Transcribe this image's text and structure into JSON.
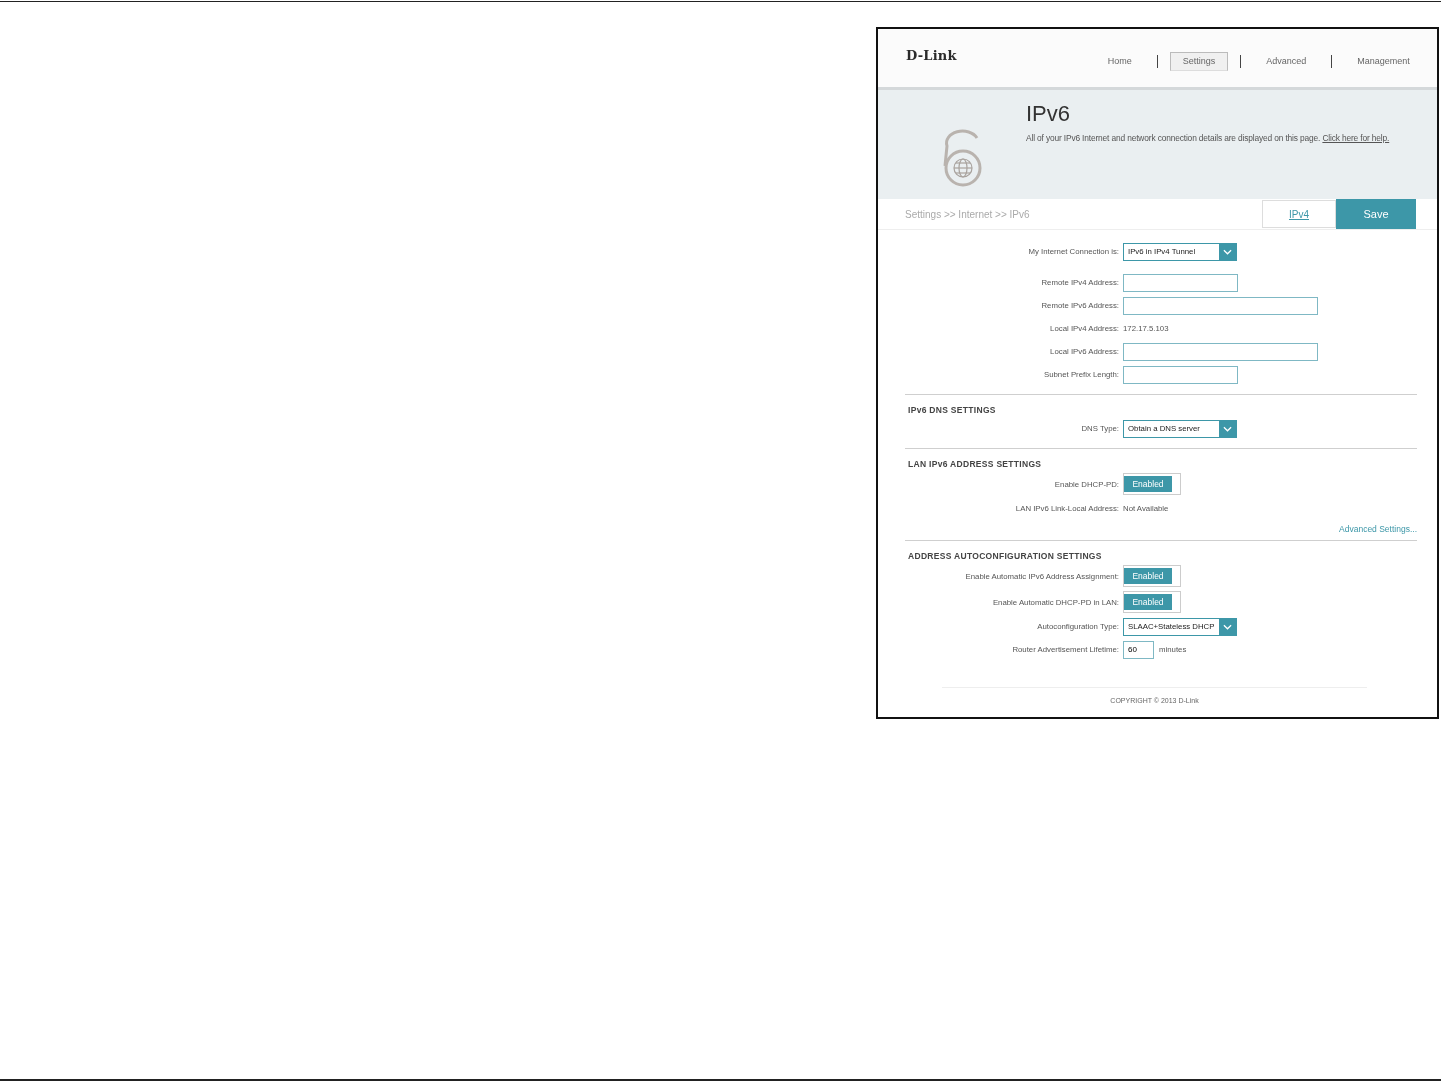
{
  "header": {
    "logo": "D-Link",
    "nav": [
      {
        "label": "Home",
        "selected": false
      },
      {
        "label": "Settings",
        "selected": true
      },
      {
        "label": "Advanced",
        "selected": false
      },
      {
        "label": "Management",
        "selected": false
      }
    ]
  },
  "hero": {
    "title": "IPv6",
    "description": "All of your IPv6 Internet and network connection details are displayed on this page.",
    "help_link": "Click here for help."
  },
  "toolbar": {
    "breadcrumb": "Settings >> Internet >> IPv6",
    "link": "IPv4",
    "save": "Save"
  },
  "sections": [
    {
      "rows": [
        {
          "kind": "select",
          "label": "My Internet Connection is:",
          "value": "IPv6 in IPv4 Tunnel"
        },
        {
          "kind": "field",
          "label": "Remote IPv4 Address:"
        },
        {
          "kind": "long-field",
          "label": "Remote IPv6 Address:"
        },
        {
          "kind": "text",
          "label": "Local IPv4 Address:",
          "value": "172.17.5.103"
        },
        {
          "kind": "long-field",
          "label": "Local IPv6 Address:"
        },
        {
          "kind": "field",
          "label": "Subnet Prefix Length:"
        }
      ]
    },
    {
      "heading": "IPv6 DNS SETTINGS",
      "rows": [
        {
          "kind": "select",
          "label": "DNS Type:",
          "value": "Obtain a DNS server"
        }
      ]
    },
    {
      "heading": "LAN IPv6 ADDRESS SETTINGS",
      "rows": [
        {
          "kind": "toggle",
          "label": "Enable DHCP-PD:",
          "value": "Enabled",
          "on": true
        },
        {
          "kind": "text",
          "label": "LAN IPv6 Link-Local Address:",
          "value": "Not Available"
        }
      ],
      "link": "Advanced Settings..."
    },
    {
      "heading": "ADDRESS AUTOCONFIGURATION SETTINGS",
      "rows": [
        {
          "kind": "toggle",
          "label": "Enable Automatic IPv6 Address Assignment:",
          "value": "Enabled",
          "on": true
        },
        {
          "kind": "toggle",
          "label": "Enable Automatic DHCP-PD in LAN:",
          "value": "Enabled",
          "on": true
        },
        {
          "kind": "select",
          "label": "Autoconfiguration Type:",
          "value": "SLAAC+Stateless DHCP"
        },
        {
          "kind": "number",
          "label": "Router Advertisement Lifetime:",
          "value": "60",
          "unit": "minutes"
        }
      ]
    }
  ],
  "footer": {
    "copyright": "COPYRIGHT © 2013 D-Link"
  }
}
